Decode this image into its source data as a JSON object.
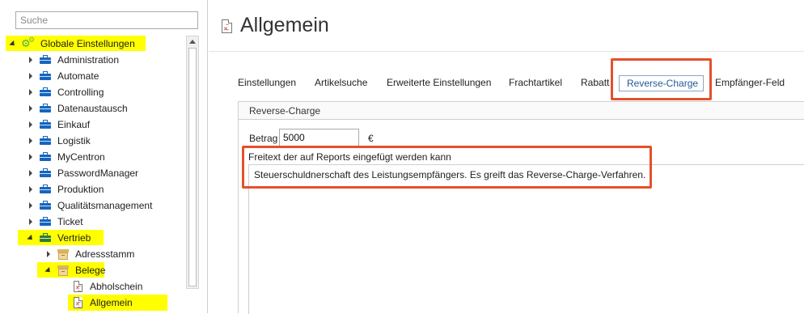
{
  "search": {
    "placeholder": "Suche"
  },
  "tree": {
    "root": "Globale Einstellungen",
    "items": [
      "Administration",
      "Automate",
      "Controlling",
      "Datenaustausch",
      "Einkauf",
      "Logistik",
      "MyCentron",
      "PasswordManager",
      "Produktion",
      "Qualitätsmanagement",
      "Ticket"
    ],
    "vertrieb": "Vertrieb",
    "adressstamm": "Adressstamm",
    "belege": "Belege",
    "abholschein": "Abholschein",
    "allgemein": "Allgemein"
  },
  "page": {
    "title": "Allgemein"
  },
  "tabs": [
    "Einstellungen",
    "Artikelsuche",
    "Erweiterte Einstellungen",
    "Frachtartikel",
    "Rabatt",
    "Reverse-Charge",
    "Empfänger-Feld"
  ],
  "active_tab": "Reverse-Charge",
  "panel": {
    "title": "Reverse-Charge",
    "betrag_label": "Betrag",
    "betrag_value": "5000",
    "currency": "€",
    "freitext_label": "Freitext der auf Reports eingefügt werden kann",
    "freitext_value": "Steuerschuldnerschaft des Leistungsempfängers. Es greift das Reverse-Charge-Verfahren."
  },
  "colors": {
    "highlight": "#ffff00",
    "annotation": "#e4502b",
    "active_tab": "#1f5a96",
    "folder_blue": "#1565c0",
    "folder_green": "#2e7d32"
  },
  "icons": {
    "folder": "briefcase-icon",
    "root": "gears-icon",
    "box": "box-icon",
    "document": "document-icon",
    "expand": "chevron-right-icon",
    "collapse": "chevron-down-icon"
  }
}
